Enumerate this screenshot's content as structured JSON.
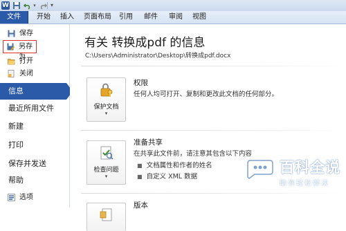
{
  "ribbon": {
    "tabs": [
      {
        "label": "文件"
      },
      {
        "label": "开始"
      },
      {
        "label": "插入"
      },
      {
        "label": "页面布局"
      },
      {
        "label": "引用"
      },
      {
        "label": "邮件"
      },
      {
        "label": "审阅"
      },
      {
        "label": "视图"
      }
    ]
  },
  "quick_access": {
    "app_icon": "W",
    "icons": [
      "word-app-icon",
      "save-icon",
      "undo-icon",
      "redo-icon",
      "customize-dropdown-icon"
    ]
  },
  "sidebar": {
    "small_items": [
      {
        "label": "保存",
        "icon": "save-icon"
      },
      {
        "label": "另存为",
        "icon": "save-as-icon"
      },
      {
        "label": "打开",
        "icon": "open-folder-icon"
      },
      {
        "label": "关闭",
        "icon": "close-document-icon"
      }
    ],
    "big_items": [
      {
        "label": "信息"
      },
      {
        "label": "最近所用文件"
      },
      {
        "label": "新建"
      },
      {
        "label": "打印"
      },
      {
        "label": "保存并发送"
      },
      {
        "label": "帮助"
      }
    ],
    "options": {
      "label": "选项",
      "icon": "options-icon"
    },
    "selected_accent": "#2a5aa8",
    "highlight_border": "#e0302e"
  },
  "main": {
    "title": "有关 转换成pdf 的信息",
    "path": "C:\\Users\\Administrator\\Desktop\\转换成pdf.docx",
    "sections": [
      {
        "button_label": "保护文档",
        "button_icon": "key-lock-icon",
        "title": "权限",
        "description": "任何人均可打开、复制和更改此文档的任何部分。"
      },
      {
        "button_label": "检查问题",
        "button_icon": "inspect-document-icon",
        "title": "准备共享",
        "description": "在共享此文件前，请注意其包含以下内容",
        "bullets": [
          "文档属性和作者的姓名",
          "自定义 XML 数据"
        ]
      },
      {
        "button_icon": "versions-icon",
        "title": "版本"
      }
    ]
  },
  "watermark": {
    "title": "百科全说",
    "subtitle": "助你轻松解决"
  }
}
